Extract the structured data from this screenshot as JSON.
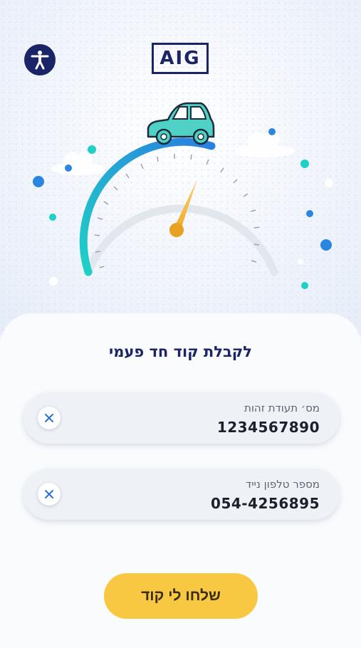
{
  "header": {
    "logo_text": "AIG",
    "accessibility_icon": "accessibility-person-icon"
  },
  "hero": {
    "illustration": "speedometer-with-car",
    "colors": {
      "gauge_start": "#22c6c8",
      "gauge_end": "#2a80e0",
      "needle": "#f5b732",
      "car": "#4fd1c5"
    }
  },
  "form": {
    "title": "לקבלת קוד חד פעמי",
    "id_field": {
      "label": "מס׳ תעודת זהות",
      "value": "1234567890",
      "clear_icon": "close-icon"
    },
    "phone_field": {
      "label": "מספר טלפון נייד",
      "value": "054-4256895",
      "clear_icon": "close-icon"
    },
    "submit_label": "שלחו לי קוד"
  },
  "colors": {
    "brand_navy": "#1b2467",
    "accent_yellow": "#f9c842",
    "clear_x": "#2d6fd1"
  }
}
